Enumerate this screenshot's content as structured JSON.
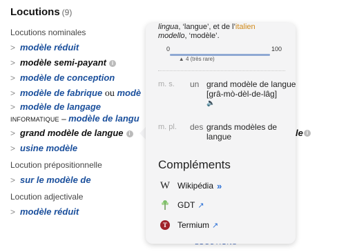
{
  "heading": {
    "title": "Locutions",
    "count": "(9)"
  },
  "sections": [
    {
      "label": "Locutions nominales"
    },
    {
      "label": "Locution prépositionnelle"
    },
    {
      "label": "Locution adjectivale"
    }
  ],
  "items": {
    "modele_reduit": "modèle réduit",
    "semi_payant": "modèle semi-payant",
    "conception": "modèle de conception",
    "fabrique": "modèle de fabrique",
    "ou": "ou",
    "mode_truncated": "modè",
    "langage": "modèle de langage",
    "informatique_tag": "INFORMATIQUE",
    "dash": " – ",
    "langue_trunc": "modèle de langu",
    "grand": "grand modèle de langue",
    "le_suffix": "le",
    "usine": "usine modèle",
    "sur": "sur le modèle de",
    "modele_reduit_adj": "modèle réduit",
    "info_glyph": "i",
    "chevron": ">"
  },
  "popup": {
    "etym": {
      "part1": "lingua",
      "part2": ", ‘langue’, et de l’",
      "part3": "italien",
      "part4": "modello",
      "part5": ", ‘modèle’."
    },
    "frequency": {
      "min": "0",
      "max": "100",
      "value": 4,
      "value_label": "4 (très rare)"
    },
    "grammar": [
      {
        "code": "m. s.",
        "det": "un",
        "form": "grand modèle de langue",
        "pron": "[grâ-mò-dèl-de-lâg]",
        "sound": "🔈"
      },
      {
        "code": "m. pl.",
        "det": "des",
        "form": "grands modèles de langue"
      }
    ],
    "complements_title": "Compléments",
    "resources": [
      {
        "label": "Wikipédia",
        "icon": "wikipedia-icon",
        "glyph": "W",
        "suffix": "»"
      },
      {
        "label": "GDT",
        "icon": "gdt-tree-icon",
        "suffix": "↗"
      },
      {
        "label": "Termium",
        "icon": "termium-icon",
        "glyph": "T",
        "suffix": "↗"
      }
    ]
  },
  "footer_link": "LOCUTIONS"
}
